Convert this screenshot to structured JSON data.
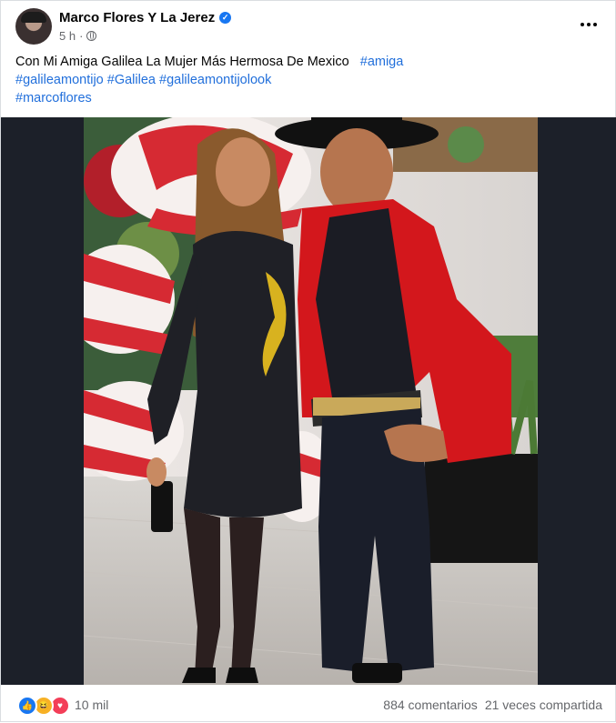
{
  "post": {
    "author": "Marco Flores Y La Jerez",
    "time": "5 h",
    "separator": "·",
    "caption_text": "Con Mi Amiga Galilea La Mujer Más Hermosa De Mexico",
    "hashtags": [
      "#amiga",
      "#galileamontijo",
      "#Galilea",
      "#galileamontijolook",
      "#marcoflores"
    ],
    "reactions_count": "10 mil",
    "comments": "884 comentarios",
    "shares": "21 veces compartida"
  },
  "icons": {
    "verified": "verified-badge-icon",
    "privacy": "globe-icon",
    "more": "more-options-icon",
    "reactions": [
      "like-icon",
      "haha-icon",
      "love-icon"
    ]
  },
  "colors": {
    "link": "#216fdb",
    "verified": "#1877f2",
    "muted": "#65676b",
    "photo_background": "#1c2029"
  }
}
